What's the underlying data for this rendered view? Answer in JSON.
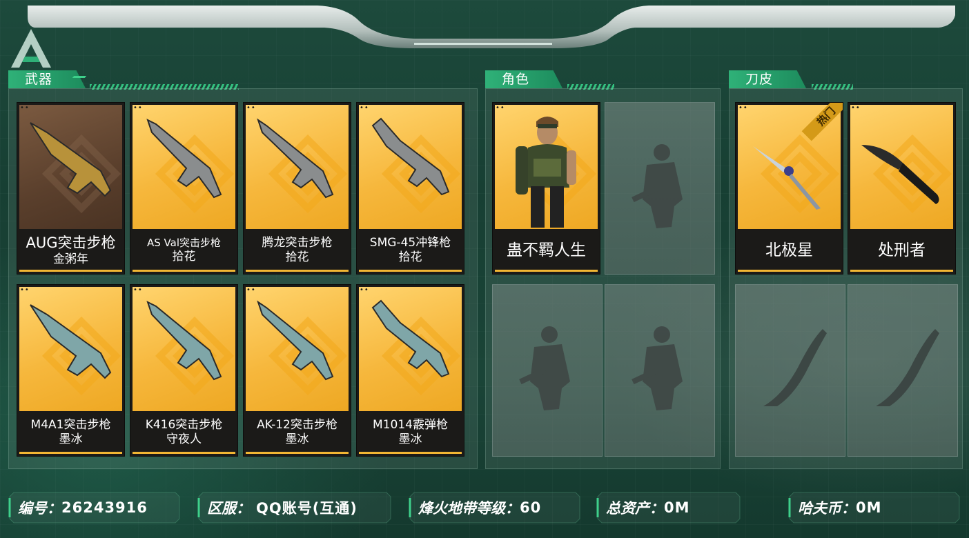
{
  "colors": {
    "accent_green": "#2fb178",
    "card_gold": "#f6b73c",
    "card_bronze": "#5a3f2c",
    "hot_badge": "#d49a18"
  },
  "panels": {
    "weapons": {
      "title": "武器"
    },
    "characters": {
      "title": "角色"
    },
    "knife_skins": {
      "title": "刀皮"
    }
  },
  "weapons": [
    {
      "line1": "AUG突击步枪",
      "line2": "金粥年",
      "rarity": "bronze",
      "icon": "aug-rifle-icon"
    },
    {
      "line1": "AS Val突击步枪",
      "line2": "拾花",
      "rarity": "gold",
      "icon": "as-val-rifle-icon"
    },
    {
      "line1": "腾龙突击步枪",
      "line2": "拾花",
      "rarity": "gold",
      "icon": "tenglong-rifle-icon"
    },
    {
      "line1": "SMG-45冲锋枪",
      "line2": "拾花",
      "rarity": "gold",
      "icon": "smg45-icon"
    },
    {
      "line1": "M4A1突击步枪",
      "line2": "墨冰",
      "rarity": "gold",
      "icon": "m4a1-rifle-icon"
    },
    {
      "line1": "K416突击步枪",
      "line2": "守夜人",
      "rarity": "gold",
      "icon": "k416-rifle-icon"
    },
    {
      "line1": "AK-12突击步枪",
      "line2": "墨冰",
      "rarity": "gold",
      "icon": "ak12-rifle-icon"
    },
    {
      "line1": "M1014霰弹枪",
      "line2": "墨冰",
      "rarity": "gold",
      "icon": "m1014-shotgun-icon"
    }
  ],
  "characters": [
    {
      "name": "蛊不羁人生",
      "icon": "operator-portrait-icon"
    }
  ],
  "knives": [
    {
      "name": "北极星",
      "badge": "热门",
      "icon": "polaris-knife-icon"
    },
    {
      "name": "处刑者",
      "icon": "executioner-knife-icon"
    }
  ],
  "rarity_dots": "••",
  "info_bar": {
    "id_label": "编号：",
    "id_value": "26243916",
    "server_label": "区服：",
    "server_value": "QQ账号(互通)",
    "level_label": "烽火地带等级：",
    "level_value": "60",
    "assets_label": "总资产：",
    "assets_value": "0M",
    "coins_label": "哈夫币：",
    "coins_value": "0M"
  }
}
